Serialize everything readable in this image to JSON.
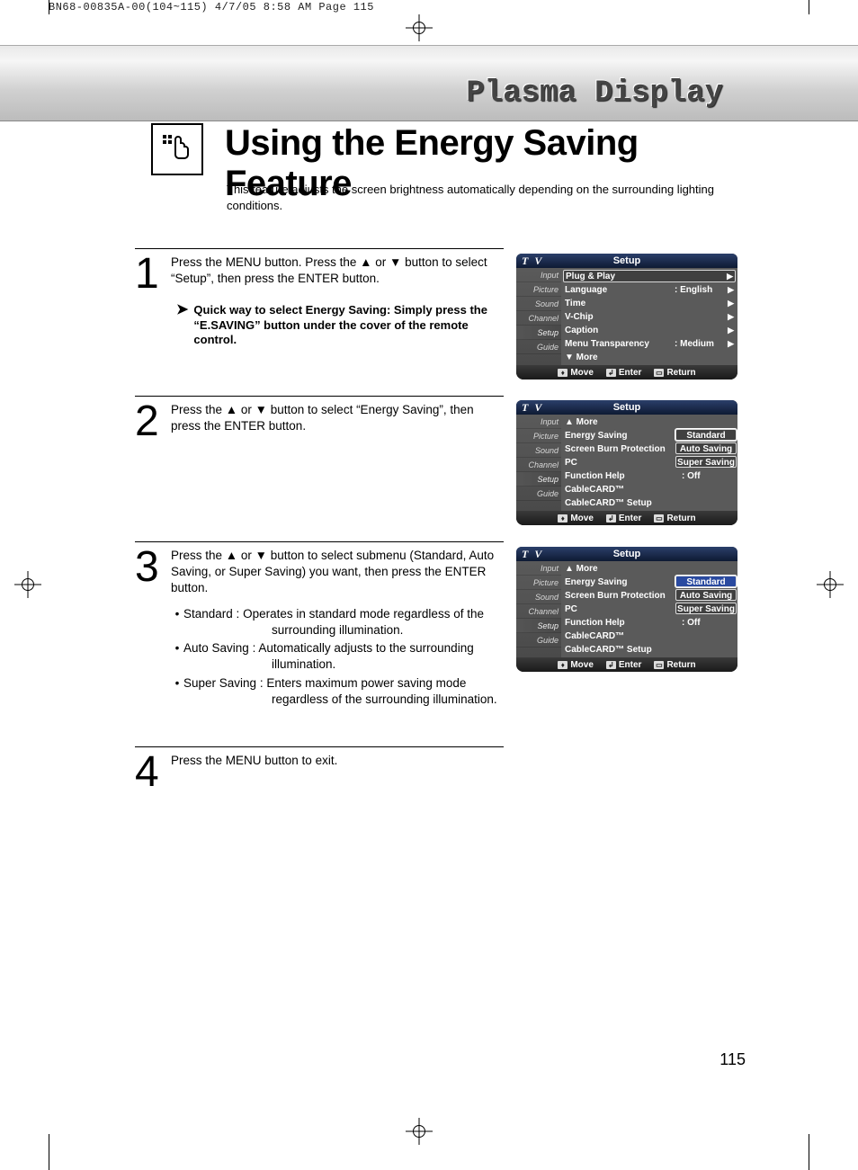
{
  "doc_meta": {
    "slug": "BN68-00835A-00(104~115)  4/7/05  8:58 AM  Page 115"
  },
  "banner": {
    "subtitle": "Plasma Display"
  },
  "page": {
    "title": "Using the Energy Saving Feature",
    "intro": "This feature adjusts the screen brightness automatically depending on the surrounding lighting conditions.",
    "number": "115"
  },
  "steps": [
    {
      "num": "1",
      "text": "Press the MENU button. Press the ▲ or ▼ button to select “Setup”, then press the ENTER button.",
      "note": "Quick way to select Energy Saving: Simply press the “E.SAVING” button under the cover of the remote control."
    },
    {
      "num": "2",
      "text": "Press the ▲ or ▼ button to select “Energy Saving”, then press the ENTER button."
    },
    {
      "num": "3",
      "text": "Press the ▲ or ▼ button to select submenu (Standard, Auto Saving, or Super Saving) you want, then press the ENTER button.",
      "bullets": [
        {
          "label": "Standard",
          "desc": "Operates in standard mode regardless of the surrounding illumination."
        },
        {
          "label": "Auto Saving",
          "desc": "Automatically adjusts to the surrounding illumination."
        },
        {
          "label": "Super Saving",
          "desc": "Enters maximum power saving mode regardless of the surrounding illumination."
        }
      ]
    },
    {
      "num": "4",
      "text": "Press the MENU button to exit."
    }
  ],
  "osd_common": {
    "corner": "T V",
    "center": "Setup",
    "tabs": [
      "Input",
      "Picture",
      "Sound",
      "Channel",
      "Setup",
      "Guide"
    ],
    "footer": {
      "move": "Move",
      "enter": "Enter",
      "return": "Return"
    }
  },
  "osd_panels": [
    {
      "rows": [
        {
          "label": "Plug & Play",
          "val": "",
          "hl": true,
          "arrow": true
        },
        {
          "label": "Language",
          "val": ": English",
          "arrow": true
        },
        {
          "label": "Time",
          "val": "",
          "arrow": true
        },
        {
          "label": "V-Chip",
          "val": "",
          "arrow": true
        },
        {
          "label": "Caption",
          "val": "",
          "arrow": true
        },
        {
          "label": "Menu Transparency",
          "val": ": Medium",
          "arrow": true
        },
        {
          "label": "▼ More",
          "val": "",
          "arrow": false
        }
      ],
      "options": []
    },
    {
      "rows": [
        {
          "label": "▲ More",
          "val": ""
        },
        {
          "label": "Energy Saving",
          "val": ":"
        },
        {
          "label": "Screen Burn Protection",
          "val": ""
        },
        {
          "label": "PC",
          "val": ""
        },
        {
          "label": "Function Help",
          "val": ": Off"
        },
        {
          "label": "CableCARD™",
          "val": ""
        },
        {
          "label": "CableCARD™ Setup",
          "val": ""
        }
      ],
      "options": [
        "Standard",
        "Auto Saving",
        "Super Saving"
      ],
      "opt_hl_index": 0
    },
    {
      "rows": [
        {
          "label": "▲ More",
          "val": ""
        },
        {
          "label": "Energy Saving",
          "val": ":"
        },
        {
          "label": "Screen Burn Protection",
          "val": ""
        },
        {
          "label": "PC",
          "val": ""
        },
        {
          "label": "Function Help",
          "val": ": Off"
        },
        {
          "label": "CableCARD™",
          "val": ""
        },
        {
          "label": "CableCARD™ Setup",
          "val": ""
        }
      ],
      "options": [
        "Standard",
        "Auto Saving",
        "Super Saving"
      ],
      "opt_hl_index": 0
    }
  ]
}
